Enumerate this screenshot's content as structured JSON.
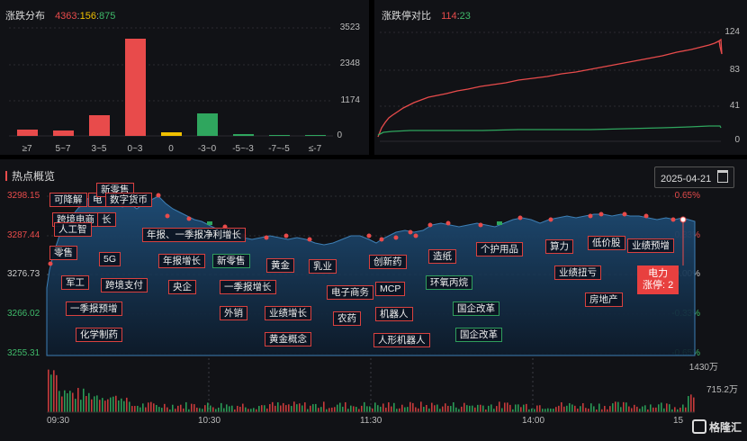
{
  "dist": {
    "title": "涨跌分布",
    "up": "4363",
    "sep1": ":",
    "flat": "156",
    "sep2": ":",
    "down": "875",
    "y_ticks": [
      "3523",
      "2348",
      "1174",
      "0"
    ],
    "colors": {
      "up": "#e84b4b",
      "flat": "#f0c000",
      "down": "#2fa65e"
    }
  },
  "ratio": {
    "title": "涨跌停对比",
    "up": "114",
    "sep": ":",
    "down": "23",
    "y_ticks": [
      "124",
      "83",
      "41",
      "0"
    ]
  },
  "overview": {
    "title": "热点概览",
    "date": "2025-04-21",
    "calendar_icon": "calendar-icon",
    "left_ticks": [
      "3298.15",
      "3287.44",
      "3276.73",
      "3266.02",
      "3255.31"
    ],
    "right_ticks": [
      "0.65%",
      "0.33%",
      "0.00%",
      "-0.33%",
      "-0.65%"
    ],
    "vol_ticks": [
      "1430万",
      "715.2万"
    ],
    "time_labels": [
      "09:30",
      "10:30",
      "11:30",
      "14:00",
      "15"
    ],
    "tags": [
      {
        "text": "可降解",
        "g": false
      },
      {
        "text": "电",
        "g": false
      },
      {
        "text": "新零售",
        "g": false
      },
      {
        "text": "数字货币",
        "g": false
      },
      {
        "text": "跨境电商",
        "g": false
      },
      {
        "text": "长",
        "g": false
      },
      {
        "text": "人工智",
        "g": false
      },
      {
        "text": "零售",
        "g": false
      },
      {
        "text": "5G",
        "g": false
      },
      {
        "text": "年报、一季报净利增长",
        "g": false
      },
      {
        "text": "年报增长",
        "g": false
      },
      {
        "text": "新零售",
        "g": true
      },
      {
        "text": "黄金",
        "g": false
      },
      {
        "text": "乳业",
        "g": false
      },
      {
        "text": "创新药",
        "g": false
      },
      {
        "text": "造纸",
        "g": false
      },
      {
        "text": "个护用品",
        "g": false
      },
      {
        "text": "算力",
        "g": false
      },
      {
        "text": "低价股",
        "g": false
      },
      {
        "text": "业绩预增",
        "g": false
      },
      {
        "text": "军工",
        "g": false
      },
      {
        "text": "跨境支付",
        "g": false
      },
      {
        "text": "央企",
        "g": false
      },
      {
        "text": "一季报增长",
        "g": false
      },
      {
        "text": "电子商务",
        "g": false
      },
      {
        "text": "MCP",
        "g": false
      },
      {
        "text": "环氧丙烷",
        "g": false
      },
      {
        "text": "业绩扭亏",
        "g": false
      },
      {
        "text": "房地产",
        "g": false
      },
      {
        "text": "一季报预增",
        "g": false
      },
      {
        "text": "外销",
        "g": false
      },
      {
        "text": "业绩增长",
        "g": false
      },
      {
        "text": "农药",
        "g": false
      },
      {
        "text": "机器人",
        "g": false
      },
      {
        "text": "国企改革",
        "g": true
      },
      {
        "text": "化学制药",
        "g": false
      },
      {
        "text": "黄金概念",
        "g": false
      },
      {
        "text": "人形机器人",
        "g": false
      },
      {
        "text": "国企改革",
        "g": true
      }
    ],
    "highlight": {
      "line1": "电力",
      "line2": "涨停: 2"
    }
  },
  "logo": {
    "text": "格隆汇",
    "icon": "gelonghui-logo-icon"
  }
}
